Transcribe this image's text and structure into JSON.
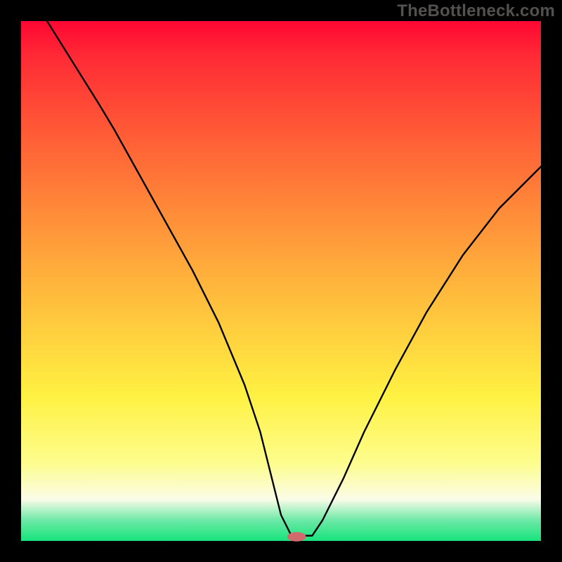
{
  "watermark": "TheBottleneck.com",
  "chart_data": {
    "type": "line",
    "title": "",
    "xlabel": "",
    "ylabel": "",
    "xlim": [
      0,
      100
    ],
    "ylim": [
      0,
      100
    ],
    "series": [
      {
        "name": "bottleneck-curve",
        "x": [
          0,
          5,
          10,
          15,
          18,
          23,
          28,
          33,
          38,
          43,
          46,
          48,
          50,
          52,
          54,
          56,
          58,
          62,
          66,
          72,
          78,
          85,
          92,
          100
        ],
        "y": [
          108,
          100,
          92,
          84,
          79,
          70,
          61,
          52,
          42,
          30,
          21,
          13,
          5,
          1,
          1,
          1,
          4,
          12,
          21,
          33,
          44,
          55,
          64,
          72
        ]
      }
    ],
    "marker": {
      "x": 53,
      "y": 0.8,
      "rx": 1.8,
      "ry": 0.9,
      "color": "#d06a6c"
    },
    "gradient_stops": [
      {
        "pos": 0,
        "color": "#ff0733"
      },
      {
        "pos": 7,
        "color": "#ff2b35"
      },
      {
        "pos": 20,
        "color": "#ff5636"
      },
      {
        "pos": 38,
        "color": "#ff8f39"
      },
      {
        "pos": 55,
        "color": "#ffc23d"
      },
      {
        "pos": 72,
        "color": "#fff142"
      },
      {
        "pos": 85,
        "color": "#fdfd8d"
      },
      {
        "pos": 92,
        "color": "#fbfce8"
      },
      {
        "pos": 96,
        "color": "#6de9a6"
      },
      {
        "pos": 100,
        "color": "#17e37d"
      }
    ]
  }
}
